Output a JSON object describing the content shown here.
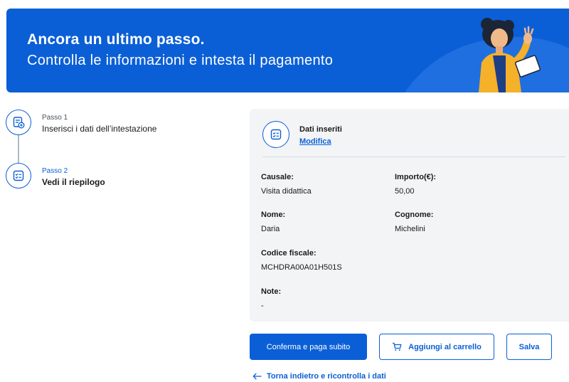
{
  "hero": {
    "title": "Ancora un ultimo passo.",
    "subtitle": "Controlla le informazioni e intesta il pagamento",
    "background_color": "#0b5fd6",
    "illustration": "woman-with-tablet-waving"
  },
  "stepper": {
    "steps": [
      {
        "number": "Passo 1",
        "label": "Inserisci i dati dell’intestazione",
        "icon": "form-edit-icon",
        "active": false
      },
      {
        "number": "Passo 2",
        "label": "Vedi il riepilogo",
        "icon": "checklist-icon",
        "active": true
      }
    ]
  },
  "summary": {
    "title": "Dati inseriti",
    "edit_link": "Modifica",
    "icon": "checklist-icon",
    "fields": {
      "causale": {
        "label": "Causale:",
        "value": "Visita didattica"
      },
      "importo": {
        "label": "Importo(€):",
        "value": "50,00"
      },
      "nome": {
        "label": "Nome:",
        "value": "Daria"
      },
      "cognome": {
        "label": "Cognome:",
        "value": "Michelini"
      },
      "codice_fiscale": {
        "label": "Codice fiscale:",
        "value": "MCHDRA00A01H501S"
      },
      "note": {
        "label": "Note:",
        "value": "-"
      }
    }
  },
  "actions": {
    "pay_now": "Conferma e paga subito",
    "add_to_cart": "Aggiungi al carrello",
    "save": "Salva",
    "back": "Torna indietro e ricontrolla i dati"
  },
  "colors": {
    "accent": "#0b5fd6",
    "card_bg": "#f3f4f6"
  }
}
